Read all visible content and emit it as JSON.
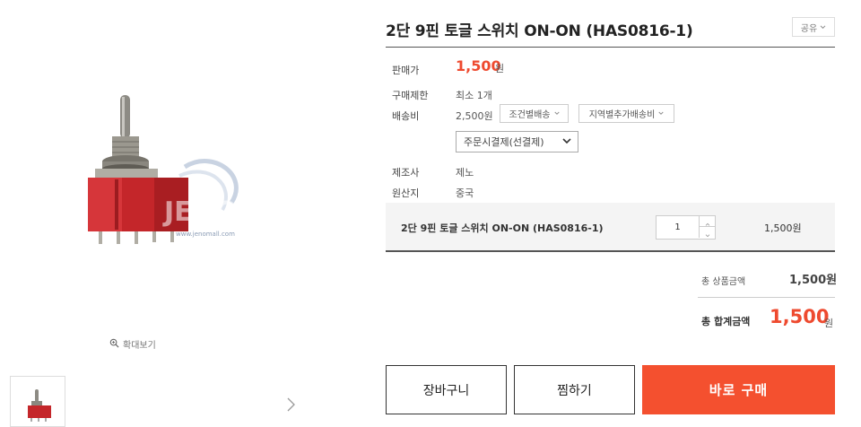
{
  "product": {
    "title": "2단 9핀 토글 스위치 ON-ON (HAS0816-1)",
    "share_label": "공유",
    "watermark": "JENO",
    "watermark_url": "www.jenomall.com"
  },
  "gallery": {
    "zoom_label": "확대보기"
  },
  "info": {
    "price_label": "판매가",
    "price_value": "1,500",
    "price_unit": "원",
    "limit_label": "구매제한",
    "limit_value": "최소 1개",
    "shipping_label": "배송비",
    "shipping_value": "2,500원",
    "shipping_cond_btn": "조건별배송",
    "shipping_region_btn": "지역별추가배송비",
    "shipping_pay_select": "주문시결제(선결제)",
    "maker_label": "제조사",
    "maker_value": "제노",
    "origin_label": "원산지",
    "origin_value": "중국"
  },
  "option": {
    "name": "2단 9핀 토글 스위치 ON-ON (HAS0816-1)",
    "quantity": "1",
    "price": "1,500원"
  },
  "summary": {
    "subtotal_label": "총 상품금액",
    "subtotal_value": "1,500원",
    "total_label": "총 합계금액",
    "total_value": "1,500",
    "total_unit": "원"
  },
  "buttons": {
    "cart": "장바구니",
    "wish": "찜하기",
    "buy": "바로 구매"
  },
  "colors": {
    "accent": "#ee4a2f",
    "buy_button": "#f4502f"
  }
}
